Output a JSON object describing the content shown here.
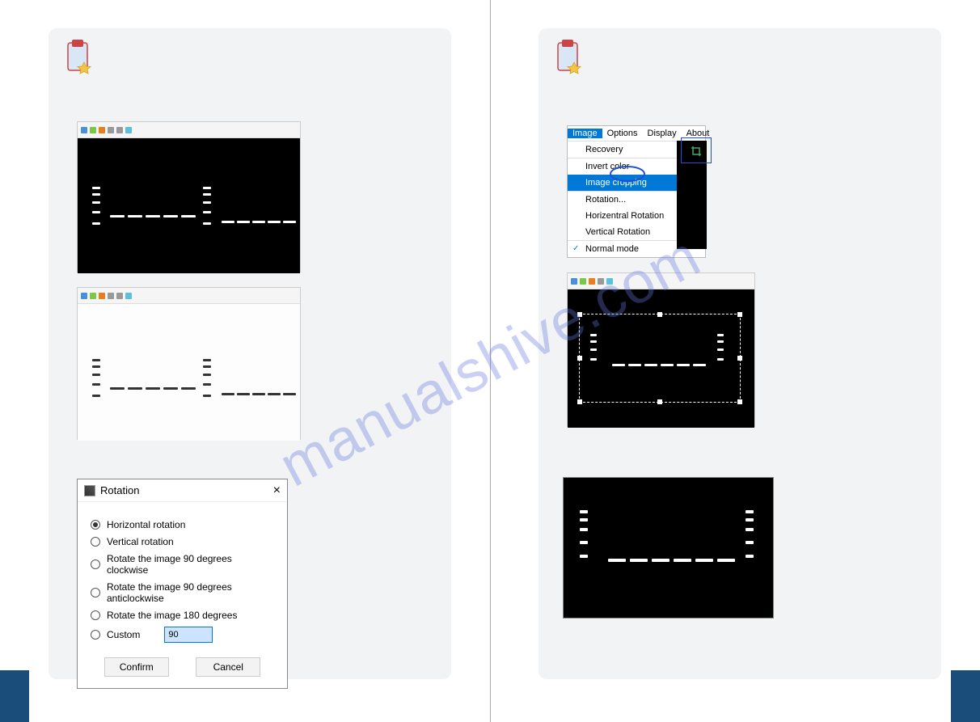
{
  "watermark": "manualshive.com",
  "left_page": {
    "rotation_dialog": {
      "title": "Rotation",
      "options": {
        "horizontal": "Horizontal rotation",
        "vertical": "Vertical rotation",
        "cw90": "Rotate the image 90 degrees clockwise",
        "ccw90": "Rotate the image 90 degrees anticlockwise",
        "r180": "Rotate the image 180 degrees",
        "custom": "Custom"
      },
      "custom_value": "90",
      "confirm": "Confirm",
      "cancel": "Cancel"
    }
  },
  "right_page": {
    "menu": {
      "bar": {
        "image": "Image",
        "options": "Options",
        "display": "Display",
        "about": "About"
      },
      "items": {
        "recovery": "Recovery",
        "invert": "Invert color",
        "cropping": "Image cropping",
        "rotation": "Rotation...",
        "hrot": "Horizentral Rotation",
        "vrot": "Vertical Rotation",
        "normal": "Normal mode"
      }
    }
  }
}
